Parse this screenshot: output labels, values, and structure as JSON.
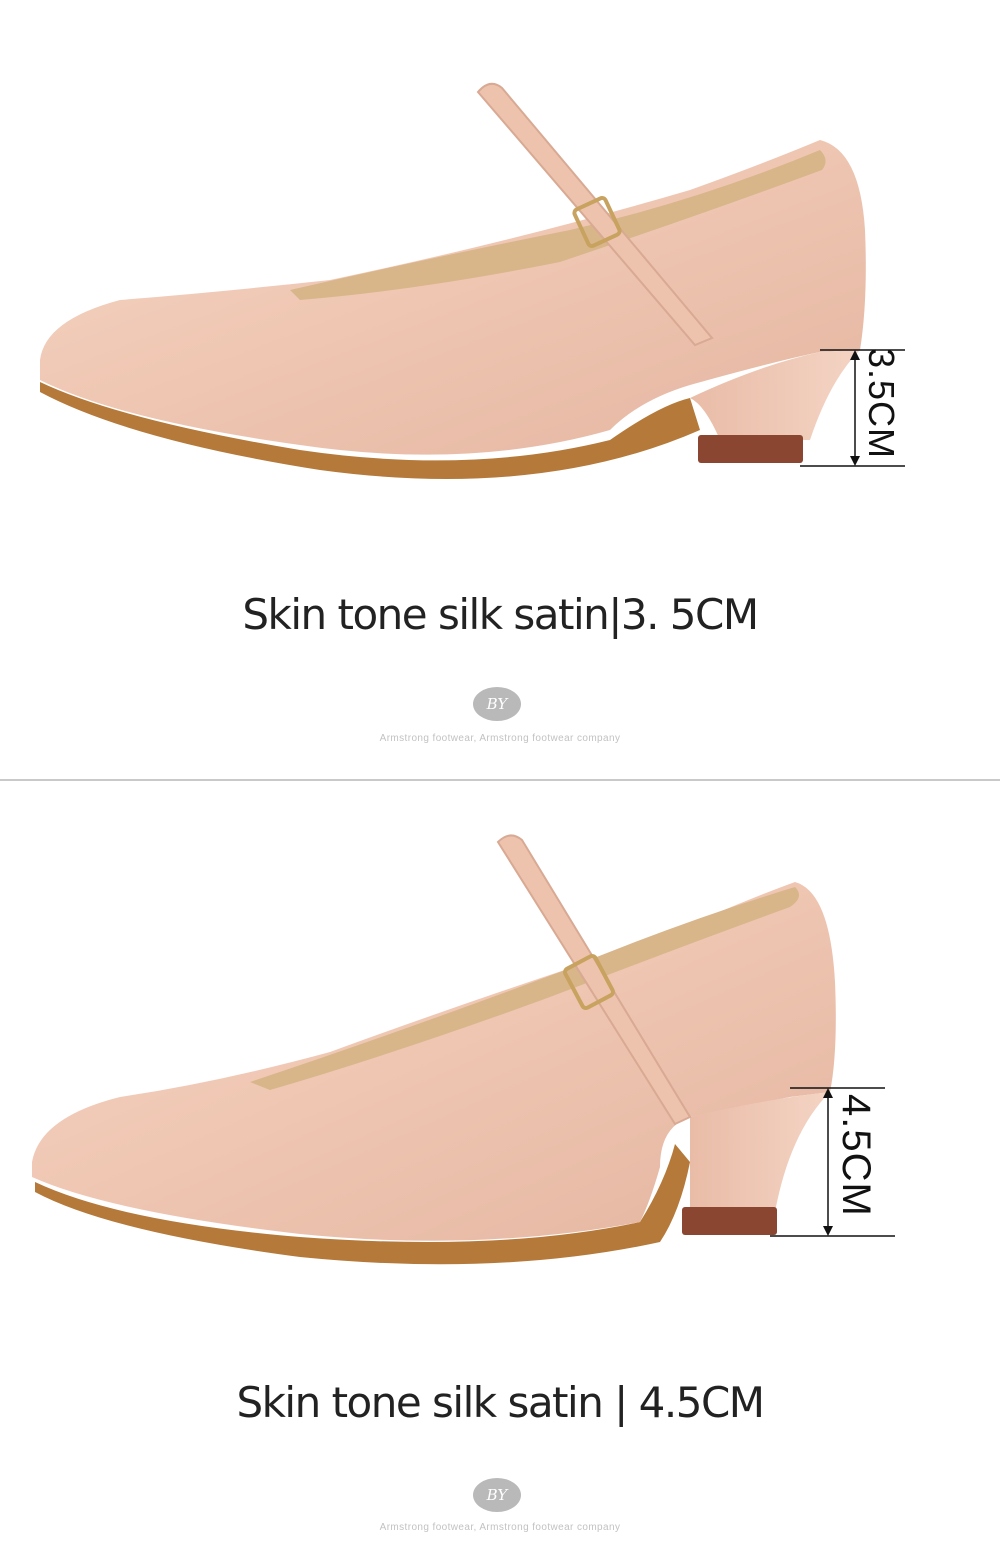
{
  "panels": [
    {
      "caption": "Skin tone silk satin|3. 5CM",
      "heel_label": "3.5CM",
      "logo_text": "BY",
      "company_text": "Armstrong footwear, Armstrong footwear company"
    },
    {
      "caption": "Skin tone silk satin | 4.5CM",
      "heel_label": "4.5CM",
      "logo_text": "BY",
      "company_text": "Armstrong footwear, Armstrong footwear company"
    }
  ],
  "colors": {
    "satin": "#f0c8b4",
    "satin_light": "#f7dccf",
    "sole": "#b5793a",
    "heel_tip": "#7a3d2a",
    "lining": "#d9b58a",
    "divider": "#c9c9c9"
  }
}
